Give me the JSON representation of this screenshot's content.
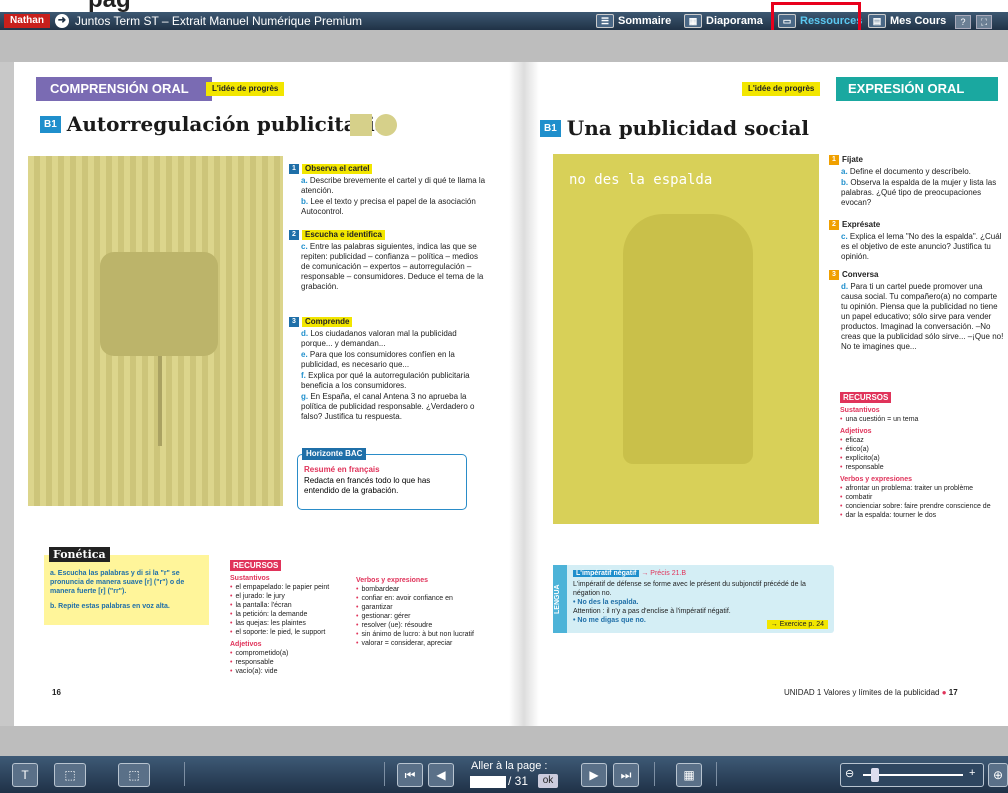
{
  "page_title_fragment": "pag",
  "app": {
    "title": "Juntos Term ST – Extrait Manuel Numérique Premium",
    "logo": "Nathan"
  },
  "toolbar": {
    "sommaire": "Sommaire",
    "diaporama": "Diaporama",
    "ressources": "Ressources",
    "mes_cours": "Mes Cours",
    "help": "?"
  },
  "nav": {
    "goto_label": "Aller à la page :",
    "page_value": "",
    "total": "/ 31",
    "ok": "ok"
  },
  "left": {
    "section": "COMPRENSIÓN ORAL",
    "tag": "L'idée de progrès",
    "badge": "B1",
    "title": "Autorregulación publicitaria",
    "blocks": [
      {
        "num": "1",
        "head": "Observa el cartel",
        "items": [
          {
            "l": "a.",
            "t": "Describe brevemente el cartel y di qué te llama la atención."
          },
          {
            "l": "b.",
            "t": "Lee el texto y precisa el papel de la asociación Autocontrol."
          }
        ]
      },
      {
        "num": "2",
        "head": "Escucha e identifica",
        "items": [
          {
            "l": "c.",
            "t": "Entre las palabras siguientes, indica las que se repiten: publicidad – confianza – política – medios de comunicación – expertos – autorregulación – responsable – consumidores. Deduce el tema de la grabación."
          }
        ]
      },
      {
        "num": "3",
        "head": "Comprende",
        "items": [
          {
            "l": "d.",
            "t": "Los ciudadanos valoran mal la publicidad porque... y demandan..."
          },
          {
            "l": "e.",
            "t": "Para que los consumidores confíen en la publicidad, es necesario que..."
          },
          {
            "l": "f.",
            "t": "Explica por qué la autorregulación publicitaria beneficia a los consumidores."
          },
          {
            "l": "g.",
            "t": "En España, el canal Antena 3 no aprueba la política de publicidad responsable. ¿Verdadero o falso? Justifica tu respuesta."
          }
        ]
      }
    ],
    "horizonte": {
      "tag": "Horizonte BAC",
      "sub": "Resumé en français",
      "text": "Redacta en francés todo lo que has entendido de la grabación."
    },
    "fonetica": {
      "tag": "Fonética",
      "a": "a. Escucha las palabras y di si la \"r\" se pronuncia de manera suave [r] (\"r\") o de manera fuerte [r] (\"rr\").",
      "b": "b. Repite estas palabras en voz alta."
    },
    "recursos": {
      "head": "RECURSOS",
      "sust_head": "Sustantivos",
      "sust": [
        "el empapelado: le papier peint",
        "el jurado: le jury",
        "la pantalla: l'écran",
        "la petición: la demande",
        "las quejas: les plaintes",
        "el soporte: le pied, le support"
      ],
      "adj_head": "Adjetivos",
      "adj": [
        "comprometido(a)",
        "responsable",
        "vacío(a): vide"
      ],
      "verb_head": "Verbos y expresiones",
      "verb": [
        "bombardear",
        "confiar en: avoir confiance en",
        "garantizar",
        "gestionar: gérer",
        "resolver (ue): résoudre",
        "sin ánimo de lucro: à but non lucratif",
        "valorar = considerar, apreciar"
      ]
    },
    "page_num": "16"
  },
  "right": {
    "section": "EXPRESIÓN ORAL",
    "tag": "L'idée de progrès",
    "badge": "B1",
    "title": "Una publicidad social",
    "poster_text": "no des la espalda",
    "blocks": [
      {
        "num": "1",
        "head": "Fíjate",
        "items": [
          {
            "l": "a.",
            "t": "Define el documento y descríbelo."
          },
          {
            "l": "b.",
            "t": "Observa la espalda de la mujer y lista las palabras. ¿Qué tipo de preocupaciones evocan?"
          }
        ]
      },
      {
        "num": "2",
        "head": "Exprésate",
        "items": [
          {
            "l": "c.",
            "t": "Explica el lema \"No des la espalda\". ¿Cuál es el objetivo de este anuncio? Justifica tu opinión."
          }
        ]
      },
      {
        "num": "3",
        "head": "Conversa",
        "items": [
          {
            "l": "d.",
            "t": "Para ti un cartel puede promover una causa social. Tu compañero(a) no comparte tu opinión. Piensa que la publicidad no tiene un papel educativo; sólo sirve para vender productos. Imaginad la conversación. –No creas que la publicidad sólo sirve... –¡Que no! No te imagines que..."
          }
        ]
      }
    ],
    "recursos": {
      "head": "RECURSOS",
      "sust_head": "Sustantivos",
      "sust": [
        "una cuestión = un tema"
      ],
      "adj_head": "Adjetivos",
      "adj": [
        "eficaz",
        "ético(a)",
        "explícito(a)",
        "responsable"
      ],
      "verb_head": "Verbos y expresiones",
      "verb": [
        "afrontar un problema: traiter un problème",
        "combatir",
        "concienciar sobre: faire prendre conscience de",
        "dar la espalda: tourner le dos"
      ]
    },
    "lengua": {
      "tag": "LENGUA",
      "head": "L'impératif négatif",
      "ref": "→ Précis 21.B",
      "l1": "L'impératif de défense se forme avec le présent du subjonctif précédé de la négation no.",
      "l2": "• No des la espalda.",
      "l3": "Attention : il n'y a pas d'enclise à l'impératif négatif.",
      "l4": "• No me digas que no.",
      "ex": "→ Exercice p. 24"
    },
    "footer": "UNIDAD 1  Valores y límites de la publicidad",
    "page_num": "17"
  },
  "colors": {
    "left_section": "#7a6bb3",
    "right_section": "#1aa8a0",
    "accent_yellow": "#f2e600",
    "accent_blue": "#1f8fcc",
    "recursos": "#e0335a"
  }
}
